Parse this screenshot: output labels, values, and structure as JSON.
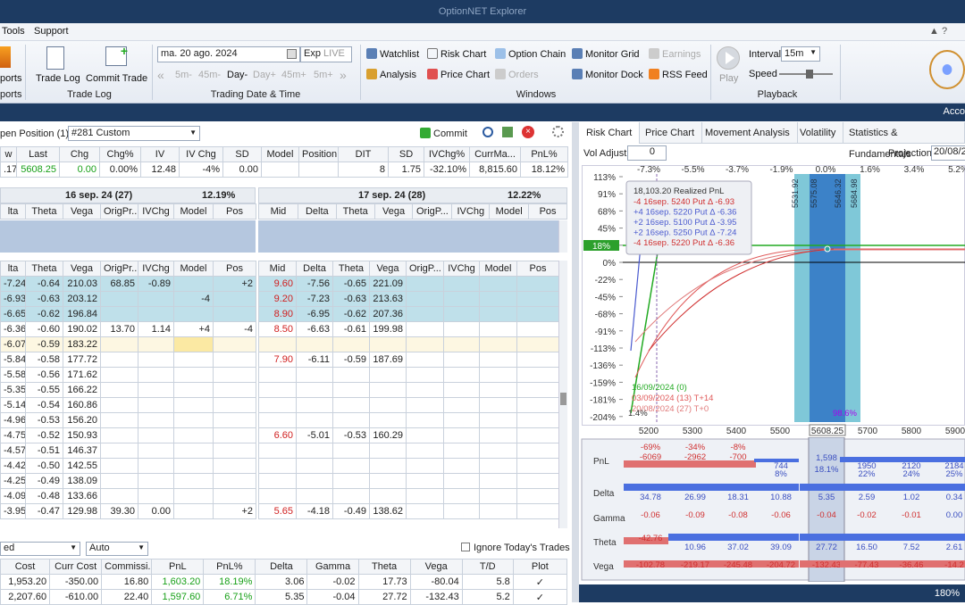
{
  "app": {
    "title": "OptionNET Explorer"
  },
  "menu": {
    "tools": "Tools",
    "support": "Support"
  },
  "ribbon": {
    "ports1": "ports",
    "ports2": "ports",
    "trade_log": "Trade Log",
    "commit_trade": "Commit Trade",
    "trade_log_group": "Trade Log",
    "date": "ma. 20 ago. 2024",
    "exp": "Exp",
    "live": "LIVE",
    "nav": [
      "5m-",
      "45m-",
      "Day-",
      "Day+",
      "45m+",
      "5m+"
    ],
    "date_group": "Trading Date & Time",
    "windows": [
      "Watchlist",
      "Risk Chart",
      "Option Chain",
      "Monitor Grid",
      "Earnings",
      "Analysis",
      "Price Chart",
      "Orders",
      "Monitor Dock",
      "RSS Feed"
    ],
    "windows_group": "Windows",
    "play": "Play",
    "interval_label": "Interval",
    "interval_value": "15m",
    "speed_label": "Speed",
    "playback_group": "Playback"
  },
  "darkbar": {
    "right": "Acco"
  },
  "position": {
    "label": "pen Position (1)",
    "select": "#281 Custom",
    "commit": "Commit"
  },
  "summary": {
    "headers": [
      "w",
      "Last",
      "Chg",
      "Chg%",
      "IV",
      "IV Chg",
      "SD",
      "Model",
      "Position",
      "DIT",
      "SD",
      "IVChg%",
      "CurrMa...",
      "PnL%"
    ],
    "values": [
      ".17",
      "5608.25",
      "0.00",
      "0.00%",
      "12.48",
      "-4%",
      "0.00",
      "",
      "",
      "8",
      "1.75",
      "-32.10%",
      "8,815.60",
      "18.12%"
    ]
  },
  "exp1": {
    "label": "16 sep. 24 (27)",
    "pct": "12.19%"
  },
  "exp2": {
    "label": "17 sep. 24 (28)",
    "pct": "12.22%"
  },
  "leftcols": [
    "lta",
    "Theta",
    "Vega",
    "OrigPr...",
    "IVChg",
    "Model",
    "Pos"
  ],
  "rightcols": [
    "Mid",
    "Delta",
    "Theta",
    "Vega",
    "OrigP...",
    "IVChg",
    "Model",
    "Pos"
  ],
  "leftrows": [
    [
      "-7.24",
      "-0.64",
      "210.03",
      "68.85",
      "-0.89",
      "",
      "+2"
    ],
    [
      "-6.93",
      "-0.63",
      "203.12",
      "",
      "",
      "-4",
      ""
    ],
    [
      "-6.65",
      "-0.62",
      "196.84",
      "",
      "",
      "",
      ""
    ],
    [
      "-6.36",
      "-0.60",
      "190.02",
      "13.70",
      "1.14",
      "+4",
      "-4"
    ],
    [
      "-6.07",
      "-0.59",
      "183.22",
      "",
      "",
      "",
      ""
    ],
    [
      "-5.84",
      "-0.58",
      "177.72",
      "",
      "",
      "",
      ""
    ],
    [
      "-5.58",
      "-0.56",
      "171.62",
      "",
      "",
      "",
      ""
    ],
    [
      "-5.35",
      "-0.55",
      "166.22",
      "",
      "",
      "",
      ""
    ],
    [
      "-5.14",
      "-0.54",
      "160.86",
      "",
      "",
      "",
      ""
    ],
    [
      "-4.96",
      "-0.53",
      "156.20",
      "",
      "",
      "",
      ""
    ],
    [
      "-4.75",
      "-0.52",
      "150.93",
      "",
      "",
      "",
      ""
    ],
    [
      "-4.57",
      "-0.51",
      "146.37",
      "",
      "",
      "",
      ""
    ],
    [
      "-4.42",
      "-0.50",
      "142.55",
      "",
      "",
      "",
      ""
    ],
    [
      "-4.25",
      "-0.49",
      "138.09",
      "",
      "",
      "",
      ""
    ],
    [
      "-4.09",
      "-0.48",
      "133.66",
      "",
      "",
      "",
      ""
    ],
    [
      "-3.95",
      "-0.47",
      "129.98",
      "39.30",
      "0.00",
      "",
      "+2"
    ]
  ],
  "rightrows": [
    [
      "9.60",
      "-7.56",
      "-0.65",
      "221.09"
    ],
    [
      "9.20",
      "-7.23",
      "-0.63",
      "213.63"
    ],
    [
      "8.90",
      "-6.95",
      "-0.62",
      "207.36"
    ],
    [
      "8.50",
      "-6.63",
      "-0.61",
      "199.98"
    ],
    [
      "",
      "",
      "",
      ""
    ],
    [
      "7.90",
      "-6.11",
      "-0.59",
      "187.69"
    ],
    [
      "",
      "",
      "",
      ""
    ],
    [
      "",
      "",
      "",
      ""
    ],
    [
      "",
      "",
      "",
      ""
    ],
    [
      "",
      "",
      "",
      ""
    ],
    [
      "6.60",
      "-5.01",
      "-0.53",
      "160.29"
    ],
    [
      "",
      "",
      "",
      ""
    ],
    [
      "",
      "",
      "",
      ""
    ],
    [
      "",
      "",
      "",
      ""
    ],
    [
      "",
      "",
      "",
      ""
    ],
    [
      "5.65",
      "-4.18",
      "-0.49",
      "138.62"
    ]
  ],
  "bottom": {
    "sel1": "ed",
    "sel2": "Auto",
    "ignore": "Ignore Today's Trades",
    "headers": [
      "Cost",
      "Curr Cost",
      "Commissi...",
      "PnL",
      "PnL%",
      "Delta",
      "Gamma",
      "Theta",
      "Vega",
      "T/D",
      "Plot"
    ],
    "rows": [
      [
        "1,953.20",
        "-350.00",
        "16.80",
        "1,603.20",
        "18.19%",
        "3.06",
        "-0.02",
        "17.73",
        "-80.04",
        "5.8",
        "✓"
      ],
      [
        "2,207.60",
        "-610.00",
        "22.40",
        "1,597.60",
        "6.71%",
        "5.35",
        "-0.04",
        "27.72",
        "-132.43",
        "5.2",
        "✓"
      ]
    ]
  },
  "righttabs": [
    "Risk Chart",
    "Price Chart",
    "Movement Analysis",
    "Volatility",
    "Statistics & Fundamentals"
  ],
  "riskctl": {
    "vol_label": "Vol Adjust",
    "vol_value": "0",
    "proj_label": "Projection",
    "proj_value": "20/08/2"
  },
  "chart_data": {
    "type": "line",
    "x_top": [
      "-7.3%",
      "-5.5%",
      "-3.7%",
      "-1.9%",
      "0.0%",
      "1.6%",
      "3.4%",
      "5.2%"
    ],
    "x_bottom": [
      "5200",
      "5300",
      "5400",
      "5500",
      "5608.25",
      "5700",
      "5800",
      "5900"
    ],
    "y_ticks": [
      "113%",
      "91%",
      "68%",
      "45%",
      "18%",
      "0%",
      "-22%",
      "-45%",
      "-68%",
      "-91%",
      "-113%",
      "-136%",
      "-159%",
      "-181%",
      "-204%"
    ],
    "current_pnl_pct": "18%",
    "vlines": [
      "5531.92",
      "5575.08",
      "5646.32",
      "5684.98"
    ],
    "legend_title": "18,103.20 Realized PnL",
    "legend": [
      "-4 16sep. 5240 Put Δ -6.93",
      "+4 16sep. 5220 Put Δ -6.36",
      "+2 16sep. 5100 Put Δ -3.95",
      "+2 16sep. 5250 Put Δ -7.24",
      "-4 16sep. 5220 Put Δ -6.36"
    ],
    "dates": [
      "16/09/2024 (0)",
      "03/09/2024 (13) T+14",
      "20/08/2024 (27) T+0"
    ],
    "left_pct": "1.4%",
    "right_pct": "98.6%"
  },
  "greeks": {
    "rows": [
      "PnL",
      "Delta",
      "Gamma",
      "Theta",
      "Vega"
    ],
    "pnl": [
      "-69%",
      "-34%",
      "-8%",
      "-6069",
      "-2962",
      "-700",
      "744",
      "8%",
      "1,598",
      "18.1%",
      "1950",
      "22%",
      "2120",
      "24%",
      "2184",
      "25%"
    ],
    "delta": [
      "34.78",
      "26.99",
      "18.31",
      "10.88",
      "5.35",
      "2.59",
      "1.02",
      "0.34"
    ],
    "gamma": [
      "-0.06",
      "-0.09",
      "-0.08",
      "-0.06",
      "-0.04",
      "-0.02",
      "-0.01",
      "0.00"
    ],
    "theta": [
      "-42.76",
      "10.96",
      "37.02",
      "39.09",
      "27.72",
      "16.50",
      "7.52",
      "2.61"
    ],
    "vega": [
      "-102.78",
      "-219.17",
      "-245.48",
      "-204.72",
      "-132.43",
      "-77.43",
      "-36.46",
      "-14.2"
    ]
  },
  "statusbar": {
    "zoom": "180%"
  }
}
